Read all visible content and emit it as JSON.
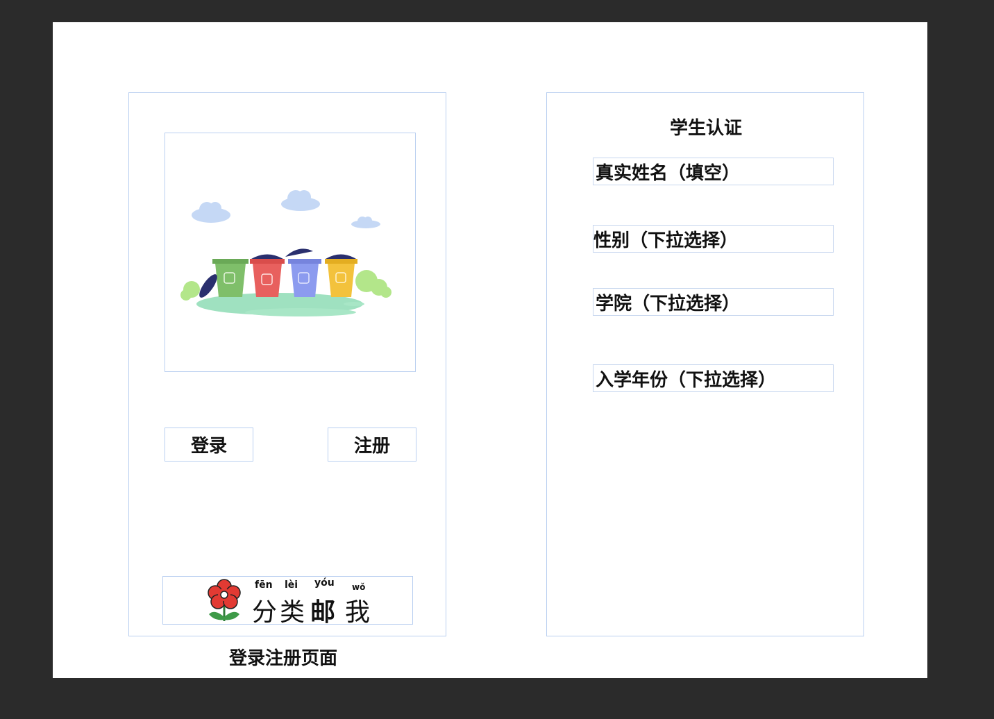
{
  "login_page": {
    "login_button": "登录",
    "register_button": "注册",
    "caption": "登录注册页面",
    "logo": {
      "pinyin": [
        "fēn",
        "lèi",
        "yóu",
        "wǒ"
      ],
      "chars": [
        "分",
        "类",
        "邮",
        "我"
      ]
    }
  },
  "auth_page": {
    "title": "学生认证",
    "fields": [
      "真实姓名（填空）",
      "性别（下拉选择）",
      "学院（下拉选择）",
      "入学年份（下拉选择）"
    ]
  },
  "colors": {
    "frame_border": "#b9cff0",
    "bin_green": "#7fbf6a",
    "bin_red": "#e8605e",
    "bin_blue": "#8c9bef",
    "bin_yellow": "#f3c23c",
    "lid": "#2a2f6e",
    "flower_red": "#e23a33"
  }
}
